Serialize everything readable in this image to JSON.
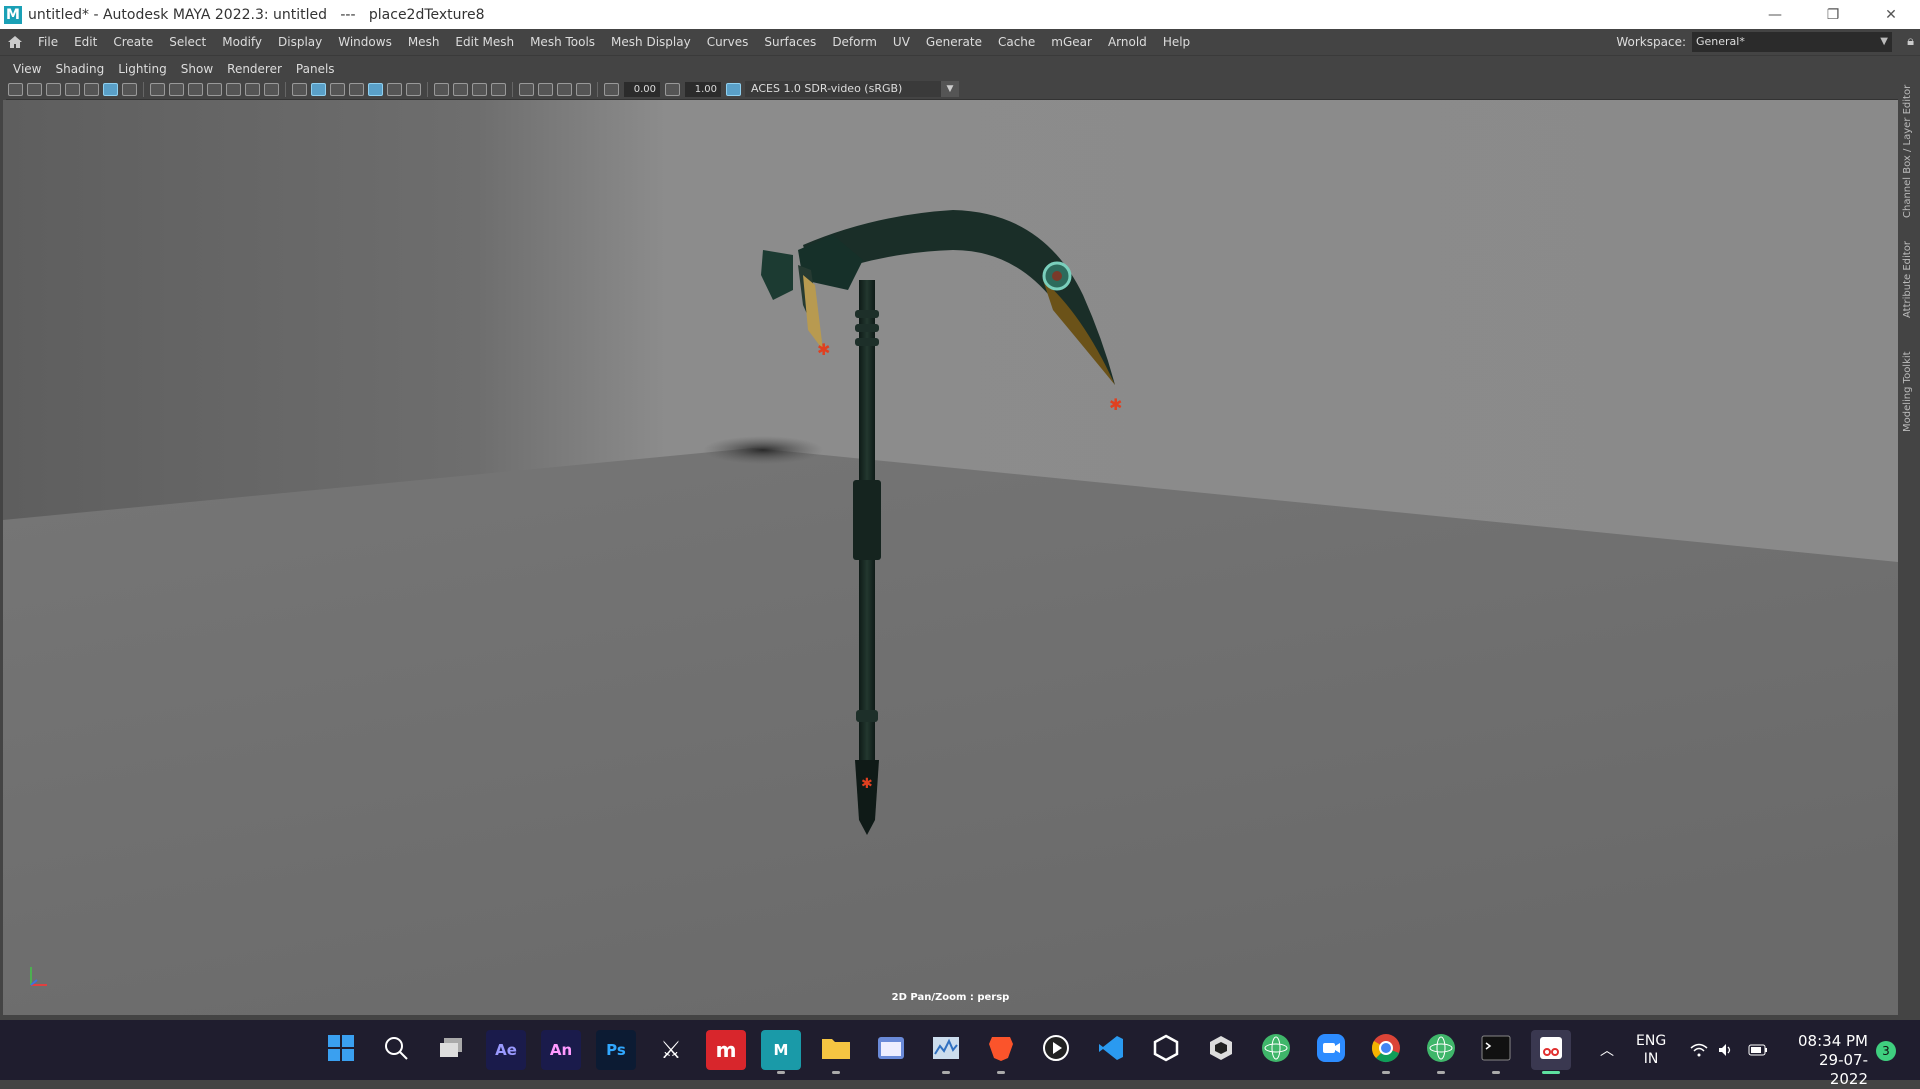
{
  "window": {
    "title": "untitled* - Autodesk MAYA 2022.3: untitled   ---   place2dTexture8",
    "app_icon_letter": "M"
  },
  "menubar": {
    "items": [
      "File",
      "Edit",
      "Create",
      "Select",
      "Modify",
      "Display",
      "Windows",
      "Mesh",
      "Edit Mesh",
      "Mesh Tools",
      "Mesh Display",
      "Curves",
      "Surfaces",
      "Deform",
      "UV",
      "Generate",
      "Cache",
      "mGear",
      "Arnold",
      "Help"
    ],
    "workspace_label": "Workspace:",
    "workspace_value": "General*"
  },
  "panel_menu": {
    "items": [
      "View",
      "Shading",
      "Lighting",
      "Show",
      "Renderer",
      "Panels"
    ]
  },
  "toolbar": {
    "exposure_value": "0.00",
    "gamma_value": "1.00",
    "color_space": "ACES 1.0 SDR-video (sRGB)"
  },
  "viewport": {
    "hud_text": "2D Pan/Zoom : persp"
  },
  "side_tabs": [
    "Channel Box / Layer Editor",
    "Attribute Editor",
    "Modeling Toolkit"
  ],
  "taskbar": {
    "apps": [
      {
        "name": "start",
        "label": ""
      },
      {
        "name": "search",
        "label": ""
      },
      {
        "name": "task-view",
        "label": ""
      },
      {
        "name": "after-effects",
        "label": "Ae"
      },
      {
        "name": "animate",
        "label": "An"
      },
      {
        "name": "photoshop",
        "label": "Ps"
      },
      {
        "name": "zbrush",
        "label": ""
      },
      {
        "name": "marmoset",
        "label": ""
      },
      {
        "name": "maya",
        "label": "M"
      },
      {
        "name": "file-explorer",
        "label": ""
      },
      {
        "name": "app-window",
        "label": ""
      },
      {
        "name": "performance-monitor",
        "label": ""
      },
      {
        "name": "brave",
        "label": ""
      },
      {
        "name": "media-player",
        "label": ""
      },
      {
        "name": "vscode",
        "label": ""
      },
      {
        "name": "unity",
        "label": ""
      },
      {
        "name": "unity-hub",
        "label": ""
      },
      {
        "name": "atom",
        "label": ""
      },
      {
        "name": "zoom",
        "label": ""
      },
      {
        "name": "chrome",
        "label": ""
      },
      {
        "name": "atom-2",
        "label": ""
      },
      {
        "name": "terminal",
        "label": ""
      },
      {
        "name": "snipping-tool",
        "label": ""
      }
    ],
    "lang_line1": "ENG",
    "lang_line2": "IN",
    "time": "08:34 PM",
    "date": "29-07-2022",
    "notification_count": "3"
  }
}
